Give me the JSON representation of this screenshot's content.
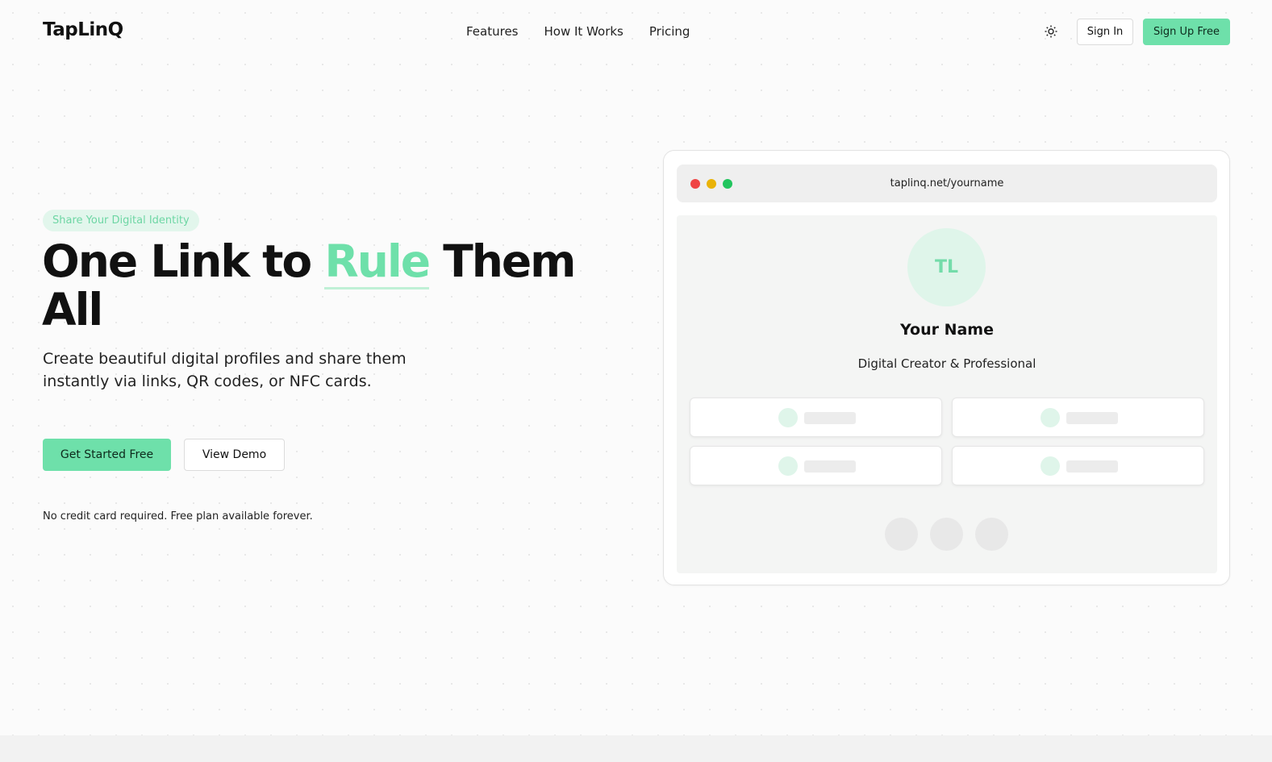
{
  "nav": {
    "logo": "TapLinQ",
    "links": [
      "Features",
      "How It Works",
      "Pricing"
    ],
    "sign_in": "Sign In",
    "sign_up": "Sign Up Free",
    "theme_icon": "sun-icon"
  },
  "hero": {
    "badge": "Share Your Digital Identity",
    "headline_before": "One Link to ",
    "headline_accent": "Rule",
    "headline_after": " Them All",
    "subtext": "Create beautiful digital profiles and share them instantly via links, QR codes, or NFC cards.",
    "cta_primary": "Get Started Free",
    "cta_secondary": "View Demo",
    "note": "No credit card required. Free plan available forever."
  },
  "preview": {
    "url": "taplinq.net/yourname",
    "avatar_initials": "TL",
    "name": "Your Name",
    "title": "Digital Creator & Professional",
    "window_dot_colors": [
      "#ef4444",
      "#eab308",
      "#22c55e"
    ]
  },
  "colors": {
    "accent": "#6ee0aa",
    "accent_light": "#e2f6ec"
  }
}
